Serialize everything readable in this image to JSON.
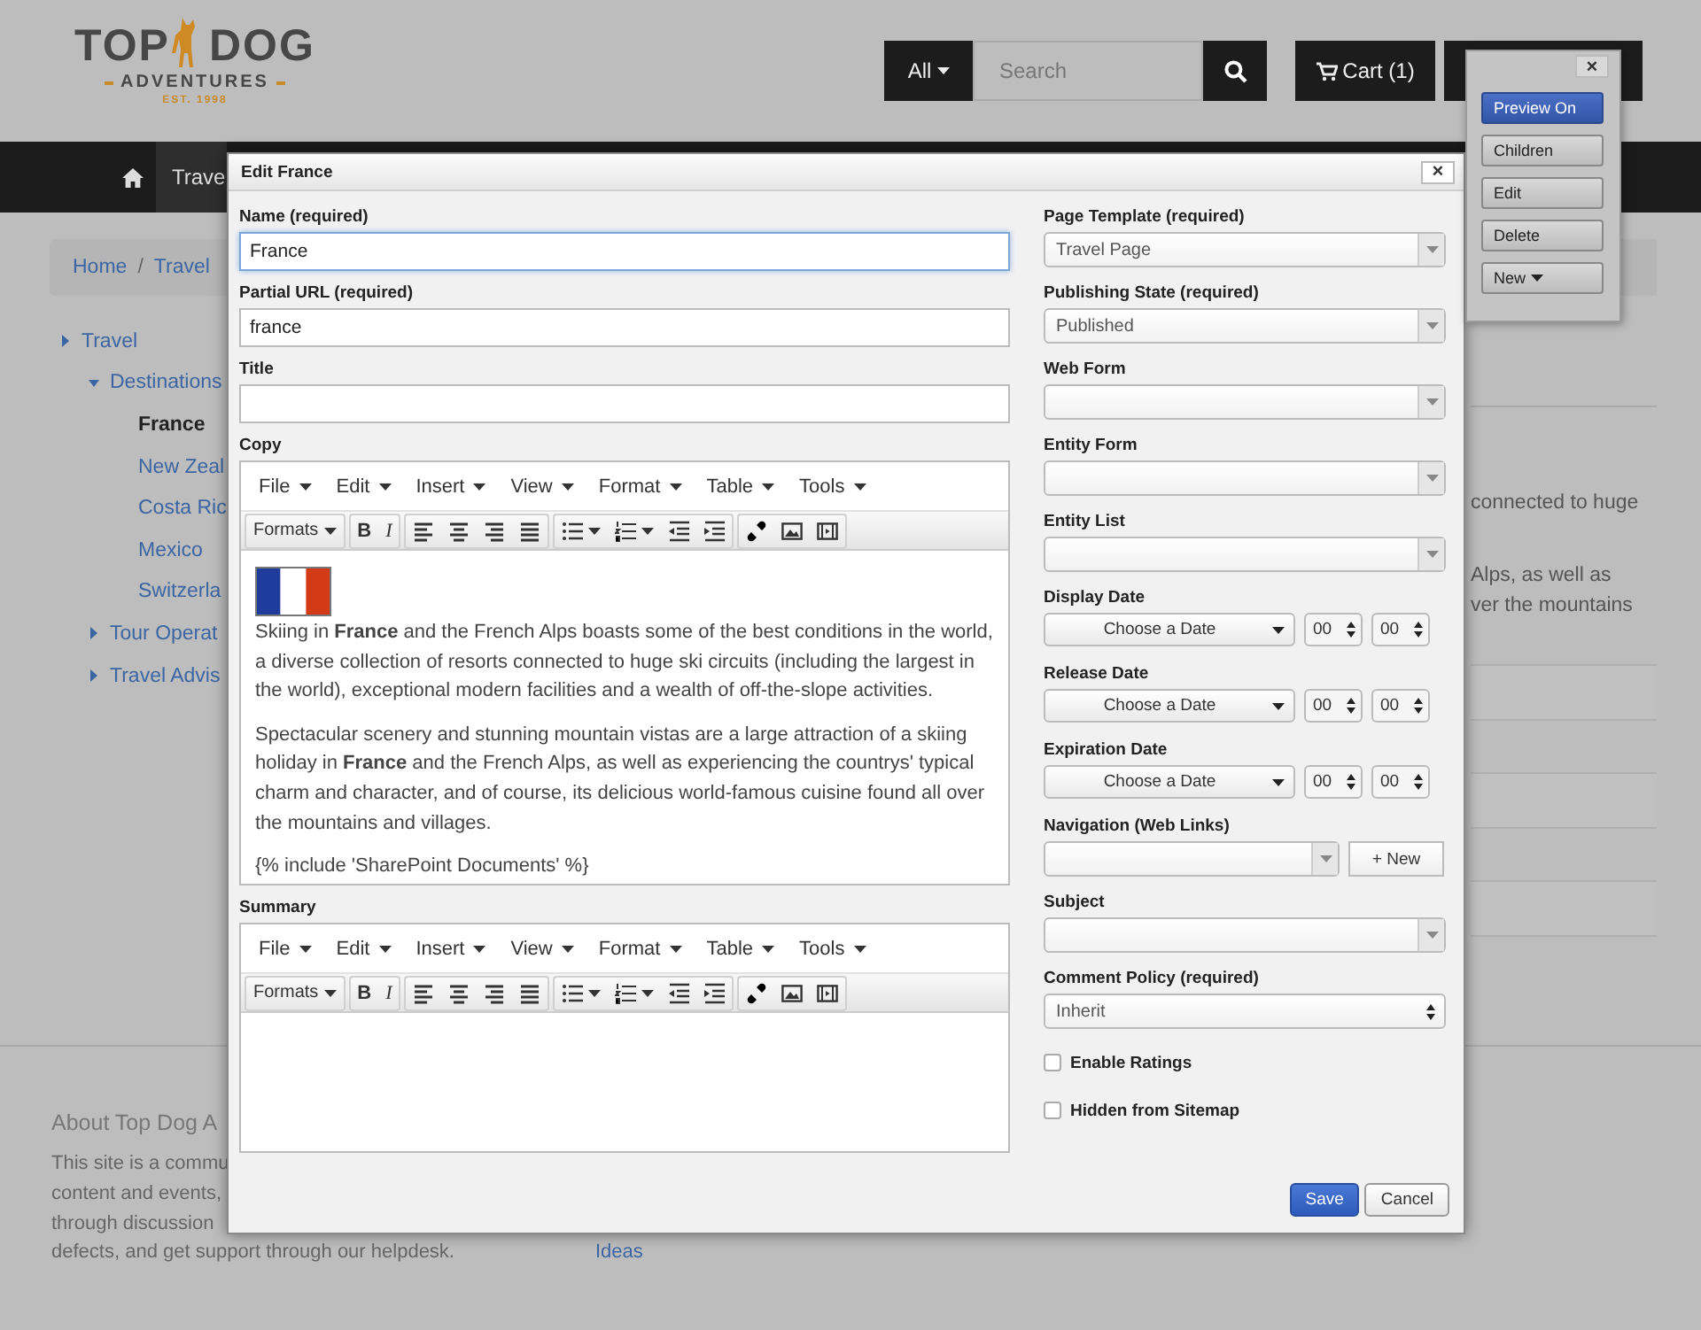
{
  "header": {
    "logo": {
      "top": "TOP",
      "dog": "DOG",
      "tagline": "ADVENTURES",
      "established": "EST. 1998"
    },
    "search": {
      "scope": "All",
      "placeholder": "Search"
    },
    "cart": "Cart (1)"
  },
  "nav": {
    "items": [
      {
        "label": "Trave",
        "selected": true
      }
    ]
  },
  "breadcrumb": {
    "items": [
      "Home",
      "Travel"
    ],
    "separator": "/"
  },
  "tree": [
    {
      "label": "Travel",
      "selected": false,
      "expanded": false,
      "children": [
        {
          "label": "Destinations",
          "selected": false,
          "expanded": true,
          "children": [
            {
              "label": "France",
              "selected": true
            },
            {
              "label": "New Zeal",
              "selected": false
            },
            {
              "label": "Costa Ric",
              "selected": false
            },
            {
              "label": "Mexico",
              "selected": false
            },
            {
              "label": "Switzerla",
              "selected": false
            }
          ]
        },
        {
          "label": "Tour Operat",
          "selected": false,
          "expanded": false
        },
        {
          "label": "Travel Advis",
          "selected": false,
          "expanded": false
        }
      ]
    }
  ],
  "content_lines": [
    "connected to huge",
    "Alps, as well as",
    "ver the mountains"
  ],
  "footer": {
    "heading": "About Top Dog A",
    "lines": [
      "This site is a commu",
      "content and events,",
      "through discussion",
      "defects, and get support through our helpdesk."
    ],
    "links": [
      "Ideas"
    ]
  },
  "dialog": {
    "title": "Edit France",
    "close": "×",
    "left_fields": [
      {
        "kind": "text",
        "label": "Name (required)",
        "value": "France",
        "focused": true
      },
      {
        "kind": "text",
        "label": "Partial URL (required)",
        "value": "france",
        "focused": false
      },
      {
        "kind": "text",
        "label": "Title",
        "focused": false
      },
      {
        "kind": "editor",
        "label": "Copy",
        "menus": [
          "File",
          "Edit",
          "Insert",
          "View",
          "Format",
          "Table",
          "Tools"
        ],
        "toolbar": [
          [
            {
              "kind": "dropdown",
              "label": "Formats"
            }
          ],
          [
            {
              "kind": "bold",
              "label": "B"
            },
            {
              "kind": "italic",
              "label": "I"
            }
          ],
          [
            {
              "kind": "align-left"
            },
            {
              "kind": "align-center"
            },
            {
              "kind": "align-right"
            },
            {
              "kind": "justify"
            }
          ],
          [
            {
              "kind": "bullet-list"
            },
            {
              "kind": "numbered-list"
            },
            {
              "kind": "outdent"
            },
            {
              "kind": "indent"
            }
          ],
          [
            {
              "kind": "link"
            },
            {
              "kind": "image"
            },
            {
              "kind": "media"
            }
          ]
        ],
        "content": [
          {
            "kind": "flag"
          },
          {
            "kind": "paragraph",
            "text": "Skiing in **France** and the French Alps boasts some of the best conditions in the world, a diverse collection of resorts connected to huge ski circuits (including the largest in the world), exceptional modern facilities and a wealth of off-the-slope activities."
          },
          {
            "kind": "paragraph",
            "text": "Spectacular scenery and stunning mountain vistas are a large attraction of a skiing holiday in **France** and the French Alps, as well as experiencing the countrys' typical charm and character, and of course, its delicious world-famous cuisine found all over the mountains and villages."
          },
          {
            "kind": "paragraph",
            "text": "{% include 'SharePoint Documents' %}"
          }
        ]
      },
      {
        "kind": "editor",
        "label": "Summary",
        "menus": [
          "File",
          "Edit",
          "Insert",
          "View",
          "Format",
          "Table",
          "Tools"
        ],
        "toolbar": [
          [
            {
              "kind": "dropdown",
              "label": "Formats"
            }
          ],
          [
            {
              "kind": "bold",
              "label": "B"
            },
            {
              "kind": "italic",
              "label": "I"
            }
          ],
          [
            {
              "kind": "align-left"
            },
            {
              "kind": "align-center"
            },
            {
              "kind": "align-right"
            },
            {
              "kind": "justify"
            }
          ],
          [
            {
              "kind": "bullet-list"
            },
            {
              "kind": "numbered-list"
            },
            {
              "kind": "outdent"
            },
            {
              "kind": "indent"
            }
          ],
          [
            {
              "kind": "link"
            },
            {
              "kind": "image"
            },
            {
              "kind": "media"
            }
          ]
        ]
      }
    ],
    "right_fields": [
      {
        "kind": "select",
        "label": "Page Template (required)",
        "value": "Travel Page"
      },
      {
        "kind": "select",
        "label": "Publishing State (required)",
        "value": "Published"
      },
      {
        "kind": "select",
        "label": "Web Form"
      },
      {
        "kind": "select",
        "label": "Entity Form"
      },
      {
        "kind": "select",
        "label": "Entity List"
      },
      {
        "kind": "date",
        "label": "Display Date",
        "button": "Choose a Date",
        "hour": "00",
        "minute": "00"
      },
      {
        "kind": "date",
        "label": "Release Date",
        "button": "Choose a Date",
        "hour": "00",
        "minute": "00"
      },
      {
        "kind": "date",
        "label": "Expiration Date",
        "button": "Choose a Date",
        "hour": "00",
        "minute": "00"
      },
      {
        "kind": "select-new",
        "label": "Navigation (Web Links)",
        "button": "+ New"
      },
      {
        "kind": "select",
        "label": "Subject"
      },
      {
        "kind": "spinner-select",
        "label": "Comment Policy (required)",
        "value": "Inherit"
      },
      {
        "kind": "checkbox",
        "label": "Enable Ratings",
        "checked": false
      },
      {
        "kind": "checkbox",
        "label": "Hidden from Sitemap",
        "checked": false
      }
    ],
    "buttons": [
      {
        "label": "Save",
        "kind": "primary"
      },
      {
        "label": "Cancel",
        "kind": "default"
      }
    ]
  },
  "admin_panel": {
    "close": "×",
    "buttons": [
      {
        "label": "Preview On",
        "kind": "primary"
      },
      {
        "label": "Children",
        "kind": "default"
      },
      {
        "label": "Edit",
        "kind": "default"
      },
      {
        "label": "Delete",
        "kind": "default"
      },
      {
        "label": "New",
        "kind": "menu"
      }
    ]
  }
}
